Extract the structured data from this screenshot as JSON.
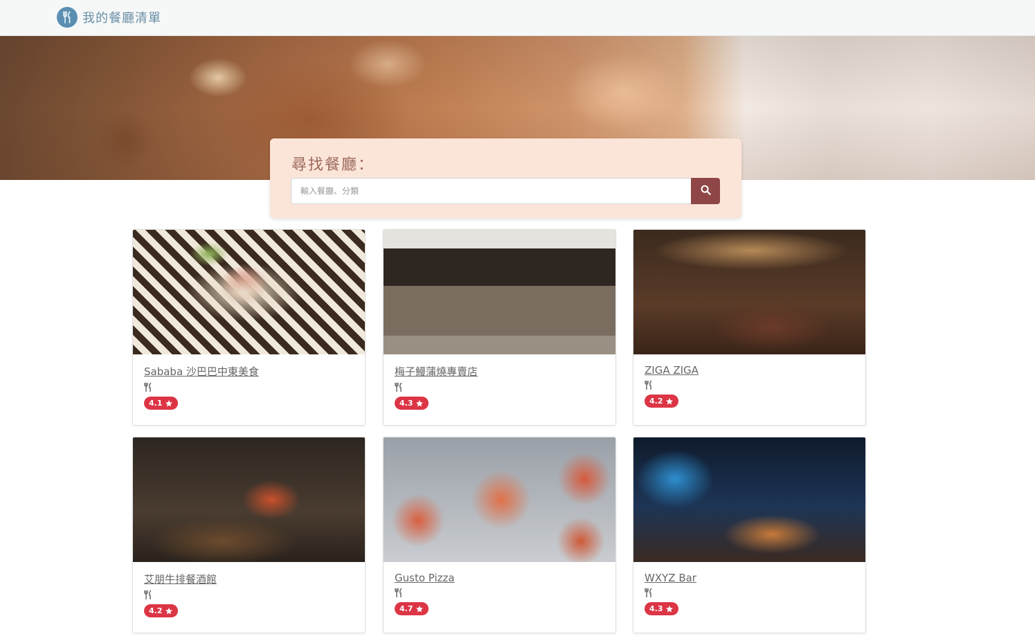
{
  "app": {
    "brand_title": "我的餐廳清單",
    "brand_icon": "utensils-icon"
  },
  "search": {
    "title": "尋找餐廳：",
    "placeholder": "輸入餐廳、分類",
    "value": "",
    "button_icon": "search-icon"
  },
  "colors": {
    "brand_blue": "#5b8fb2",
    "search_button": "#8e4646",
    "rating_badge": "#dc3545",
    "search_panel": "#fbe5d8"
  },
  "restaurants": [
    {
      "name": "Sababa 沙巴巴中東美食",
      "category_icon": "utensils-icon",
      "rating": "4.1"
    },
    {
      "name": "梅子鰻蒲燒專賣店",
      "category_icon": "utensils-icon",
      "rating": "4.3"
    },
    {
      "name": "ZIGA ZIGA",
      "category_icon": "utensils-icon",
      "rating": "4.2"
    },
    {
      "name": "艾朋牛排餐酒館",
      "category_icon": "utensils-icon",
      "rating": "4.2"
    },
    {
      "name": "Gusto Pizza",
      "category_icon": "utensils-icon",
      "rating": "4.7"
    },
    {
      "name": "WXYZ Bar",
      "category_icon": "utensils-icon",
      "rating": "4.3"
    }
  ]
}
